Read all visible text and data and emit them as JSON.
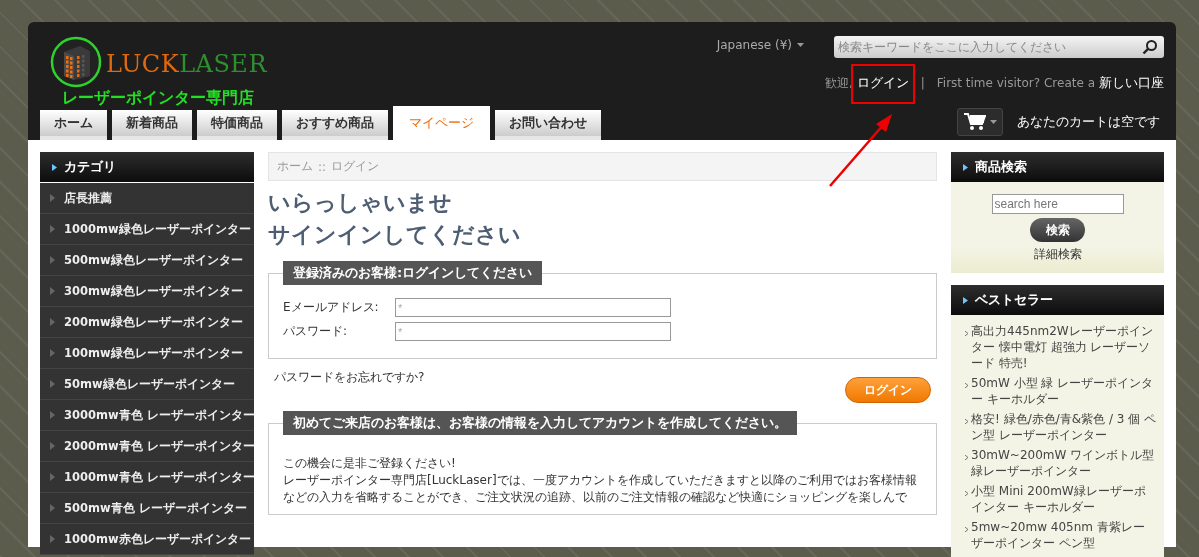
{
  "header": {
    "logo": {
      "part_1": "LUCK",
      "part_2": "LASER",
      "tagline": "レーザーポインター専門店"
    },
    "language": "Japanese (¥)",
    "search": {
      "placeholder": "検索キーワードをここに入力してください"
    },
    "account": {
      "greeting": "歓迎,",
      "login": "ログイン",
      "separator": "|",
      "prompt": "First time visitor? Create a",
      "register": "新しい口座"
    },
    "cart": {
      "status": "あなたのカートは空です"
    }
  },
  "tabs": [
    {
      "label": "ホーム",
      "selected": false
    },
    {
      "label": "新着商品",
      "selected": false
    },
    {
      "label": "特価商品",
      "selected": false
    },
    {
      "label": "おすすめ商品",
      "selected": false
    },
    {
      "label": "マイページ",
      "selected": true
    },
    {
      "label": "お問い合わせ",
      "selected": false
    }
  ],
  "categories": {
    "title": "カテゴリ",
    "items": [
      "店長推薦",
      "1000mw緑色レーザーポインター",
      "500mw緑色レーザーポインター",
      "300mw緑色レーザーポインター",
      "200mw緑色レーザーポインター",
      "100mw緑色レーザーポインター",
      "50mw緑色レーザーポインター",
      "3000mw青色 レーザーポインター",
      "2000mw青色 レーザーポインター",
      "1000mw青色 レーザーポインター",
      "500mw青色 レーザーポインター",
      "1000mw赤色レーザーポインター"
    ]
  },
  "breadcrumb": {
    "items": [
      "ホーム",
      "ログイン"
    ],
    "separator": "::"
  },
  "heading": [
    "いらっしゃいませ",
    "サインインしてください"
  ],
  "login_form": {
    "legend": "登録済みのお客様:ログインしてください",
    "fields": [
      {
        "label": "Eメールアドレス:",
        "placeholder": "*"
      },
      {
        "label": "パスワード:",
        "placeholder": "*"
      }
    ],
    "forgot_link": "パスワードをお忘れですか?",
    "button": "ログイン"
  },
  "register_section": {
    "legend": "初めてご来店のお客様は、お客様の情報を入力してアカウントを作成してください。",
    "paragraphs": [
      "この機会に是非ご登録ください!",
      "レーザーポインター専門店[LuckLaser]では、一度アカウントを作成していただきますと以降のご利用ではお客様情報などの入力を省略することができ、ご注文状況の追跡、以前のご注文情報の確認など快適にショッピングを楽しんで"
    ]
  },
  "product_search": {
    "title": "商品検索",
    "placeholder": "search here",
    "button": "検索",
    "advanced_link": "詳細検索"
  },
  "bestsellers": {
    "title": "ベストセラー",
    "items": [
      "高出力445nm2Wレーザーポインター 懐中電灯 超強力 レーザーソード 特売!",
      "50mW 小型 緑 レーザーポインター キーホルダー",
      "格安! 緑色/赤色/青&紫色 / 3 個 ペン型 レーザーポインター",
      "30mW~200mW ワインボトル型緑レーザーポインター",
      "小型 Mini 200mW緑レーザーポインター キーホルダー",
      "5mw~20mw 405nm 青紫レーザーポインター ペン型"
    ]
  }
}
